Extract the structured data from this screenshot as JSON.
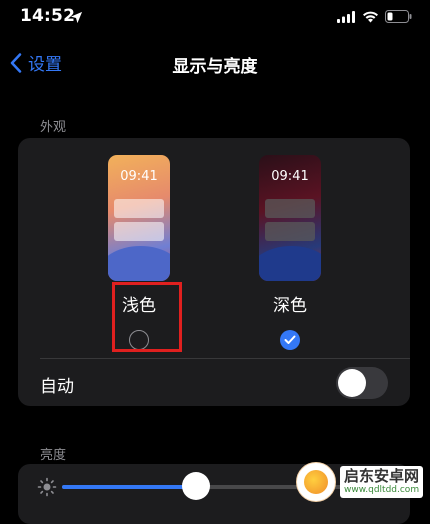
{
  "status_bar": {
    "time": "14:52"
  },
  "nav": {
    "back_label": "设置",
    "title": "显示与亮度"
  },
  "appearance": {
    "section_label": "外观",
    "light": {
      "preview_time": "09:41",
      "label": "浅色",
      "selected": false
    },
    "dark": {
      "preview_time": "09:41",
      "label": "深色",
      "selected": true
    },
    "auto_label": "自动",
    "auto_enabled": false
  },
  "brightness": {
    "section_label": "亮度",
    "level": 0.48
  },
  "watermark": {
    "title": "启东安卓网",
    "url": "www.qdltdd.com"
  },
  "colors": {
    "accent": "#3478f6",
    "highlight": "#e0201f",
    "background": "#000000",
    "card": "#1c1c1e"
  }
}
